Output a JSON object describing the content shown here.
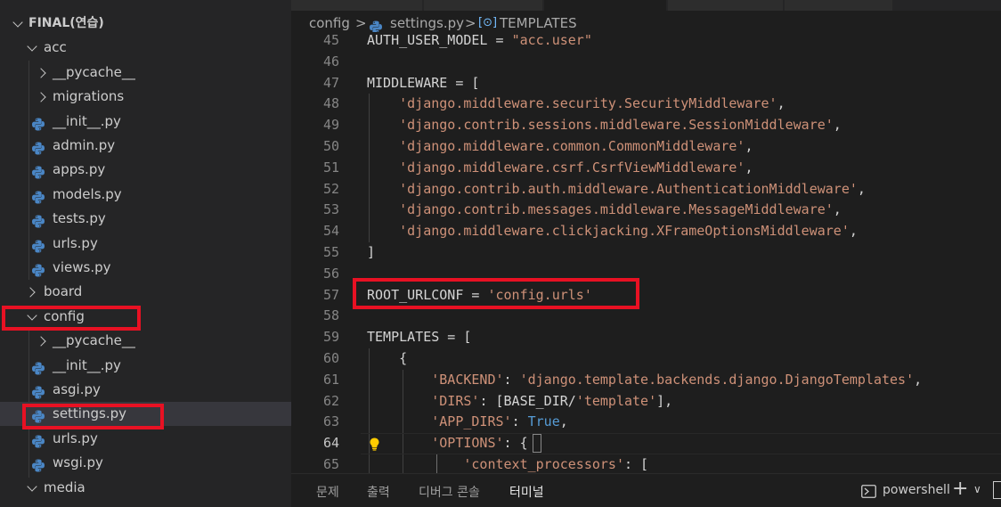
{
  "explorer": {
    "root": "FINAL(연습)",
    "items": [
      {
        "label": "acc",
        "type": "folder-open"
      },
      {
        "label": "__pycache__",
        "type": "folder-closed"
      },
      {
        "label": "migrations",
        "type": "folder-closed"
      },
      {
        "label": "__init__.py",
        "type": "python-file"
      },
      {
        "label": "admin.py",
        "type": "python-file"
      },
      {
        "label": "apps.py",
        "type": "python-file"
      },
      {
        "label": "models.py",
        "type": "python-file"
      },
      {
        "label": "tests.py",
        "type": "python-file"
      },
      {
        "label": "urls.py",
        "type": "python-file"
      },
      {
        "label": "views.py",
        "type": "python-file"
      },
      {
        "label": "board",
        "type": "folder-closed"
      },
      {
        "label": "config",
        "type": "folder-open"
      },
      {
        "label": "__pycache__",
        "type": "folder-closed"
      },
      {
        "label": "__init__.py",
        "type": "python-file"
      },
      {
        "label": "asgi.py",
        "type": "python-file"
      },
      {
        "label": "settings.py",
        "type": "python-file",
        "selected": true
      },
      {
        "label": "urls.py",
        "type": "python-file"
      },
      {
        "label": "wsgi.py",
        "type": "python-file"
      },
      {
        "label": "media",
        "type": "folder-open"
      }
    ]
  },
  "breadcrumb": {
    "folder": "config",
    "separator": ">",
    "file": "settings.py",
    "symbol": "TEMPLATES",
    "symbol_icon": "[⊙]"
  },
  "editor": {
    "current_line": "64",
    "lines": [
      {
        "n": "45",
        "text": "AUTH_USER_MODEL = \"acc.user\""
      },
      {
        "n": "46",
        "text": ""
      },
      {
        "n": "47",
        "text": "MIDDLEWARE = ["
      },
      {
        "n": "48",
        "text": "    'django.middleware.security.SecurityMiddleware',"
      },
      {
        "n": "49",
        "text": "    'django.contrib.sessions.middleware.SessionMiddleware',"
      },
      {
        "n": "50",
        "text": "    'django.middleware.common.CommonMiddleware',"
      },
      {
        "n": "51",
        "text": "    'django.middleware.csrf.CsrfViewMiddleware',"
      },
      {
        "n": "52",
        "text": "    'django.contrib.auth.middleware.AuthenticationMiddleware',"
      },
      {
        "n": "53",
        "text": "    'django.contrib.messages.middleware.MessageMiddleware',"
      },
      {
        "n": "54",
        "text": "    'django.middleware.clickjacking.XFrameOptionsMiddleware',"
      },
      {
        "n": "55",
        "text": "]"
      },
      {
        "n": "56",
        "text": ""
      },
      {
        "n": "57",
        "text": "ROOT_URLCONF = 'config.urls'"
      },
      {
        "n": "58",
        "text": ""
      },
      {
        "n": "59",
        "text": "TEMPLATES = ["
      },
      {
        "n": "60",
        "text": "    {"
      },
      {
        "n": "61",
        "text": "        'BACKEND': 'django.template.backends.django.DjangoTemplates',"
      },
      {
        "n": "62",
        "text": "        'DIRS': [BASE_DIR/'template'],"
      },
      {
        "n": "63",
        "text": "        'APP_DIRS': True,"
      },
      {
        "n": "64",
        "text": "        'OPTIONS': {"
      },
      {
        "n": "65",
        "text": "            'context_processors': ["
      }
    ]
  },
  "panel": {
    "tabs": [
      "문제",
      "출력",
      "디버그 콘솔",
      "터미널"
    ],
    "active_tab": "터미널",
    "terminal_name": "powershell",
    "add_label": "+",
    "dropdown_label": "∨"
  },
  "colors": {
    "string": "#ce9178",
    "constant": "#569cd6",
    "default_text": "#d4d4d4",
    "annotation_red": "#e81123"
  },
  "icons": {
    "chevron": "chevron-icon",
    "python": "python-file-icon",
    "lightbulb": "lightbulb-icon",
    "terminal": "terminal-icon",
    "symbol": "symbol-variable-icon"
  }
}
